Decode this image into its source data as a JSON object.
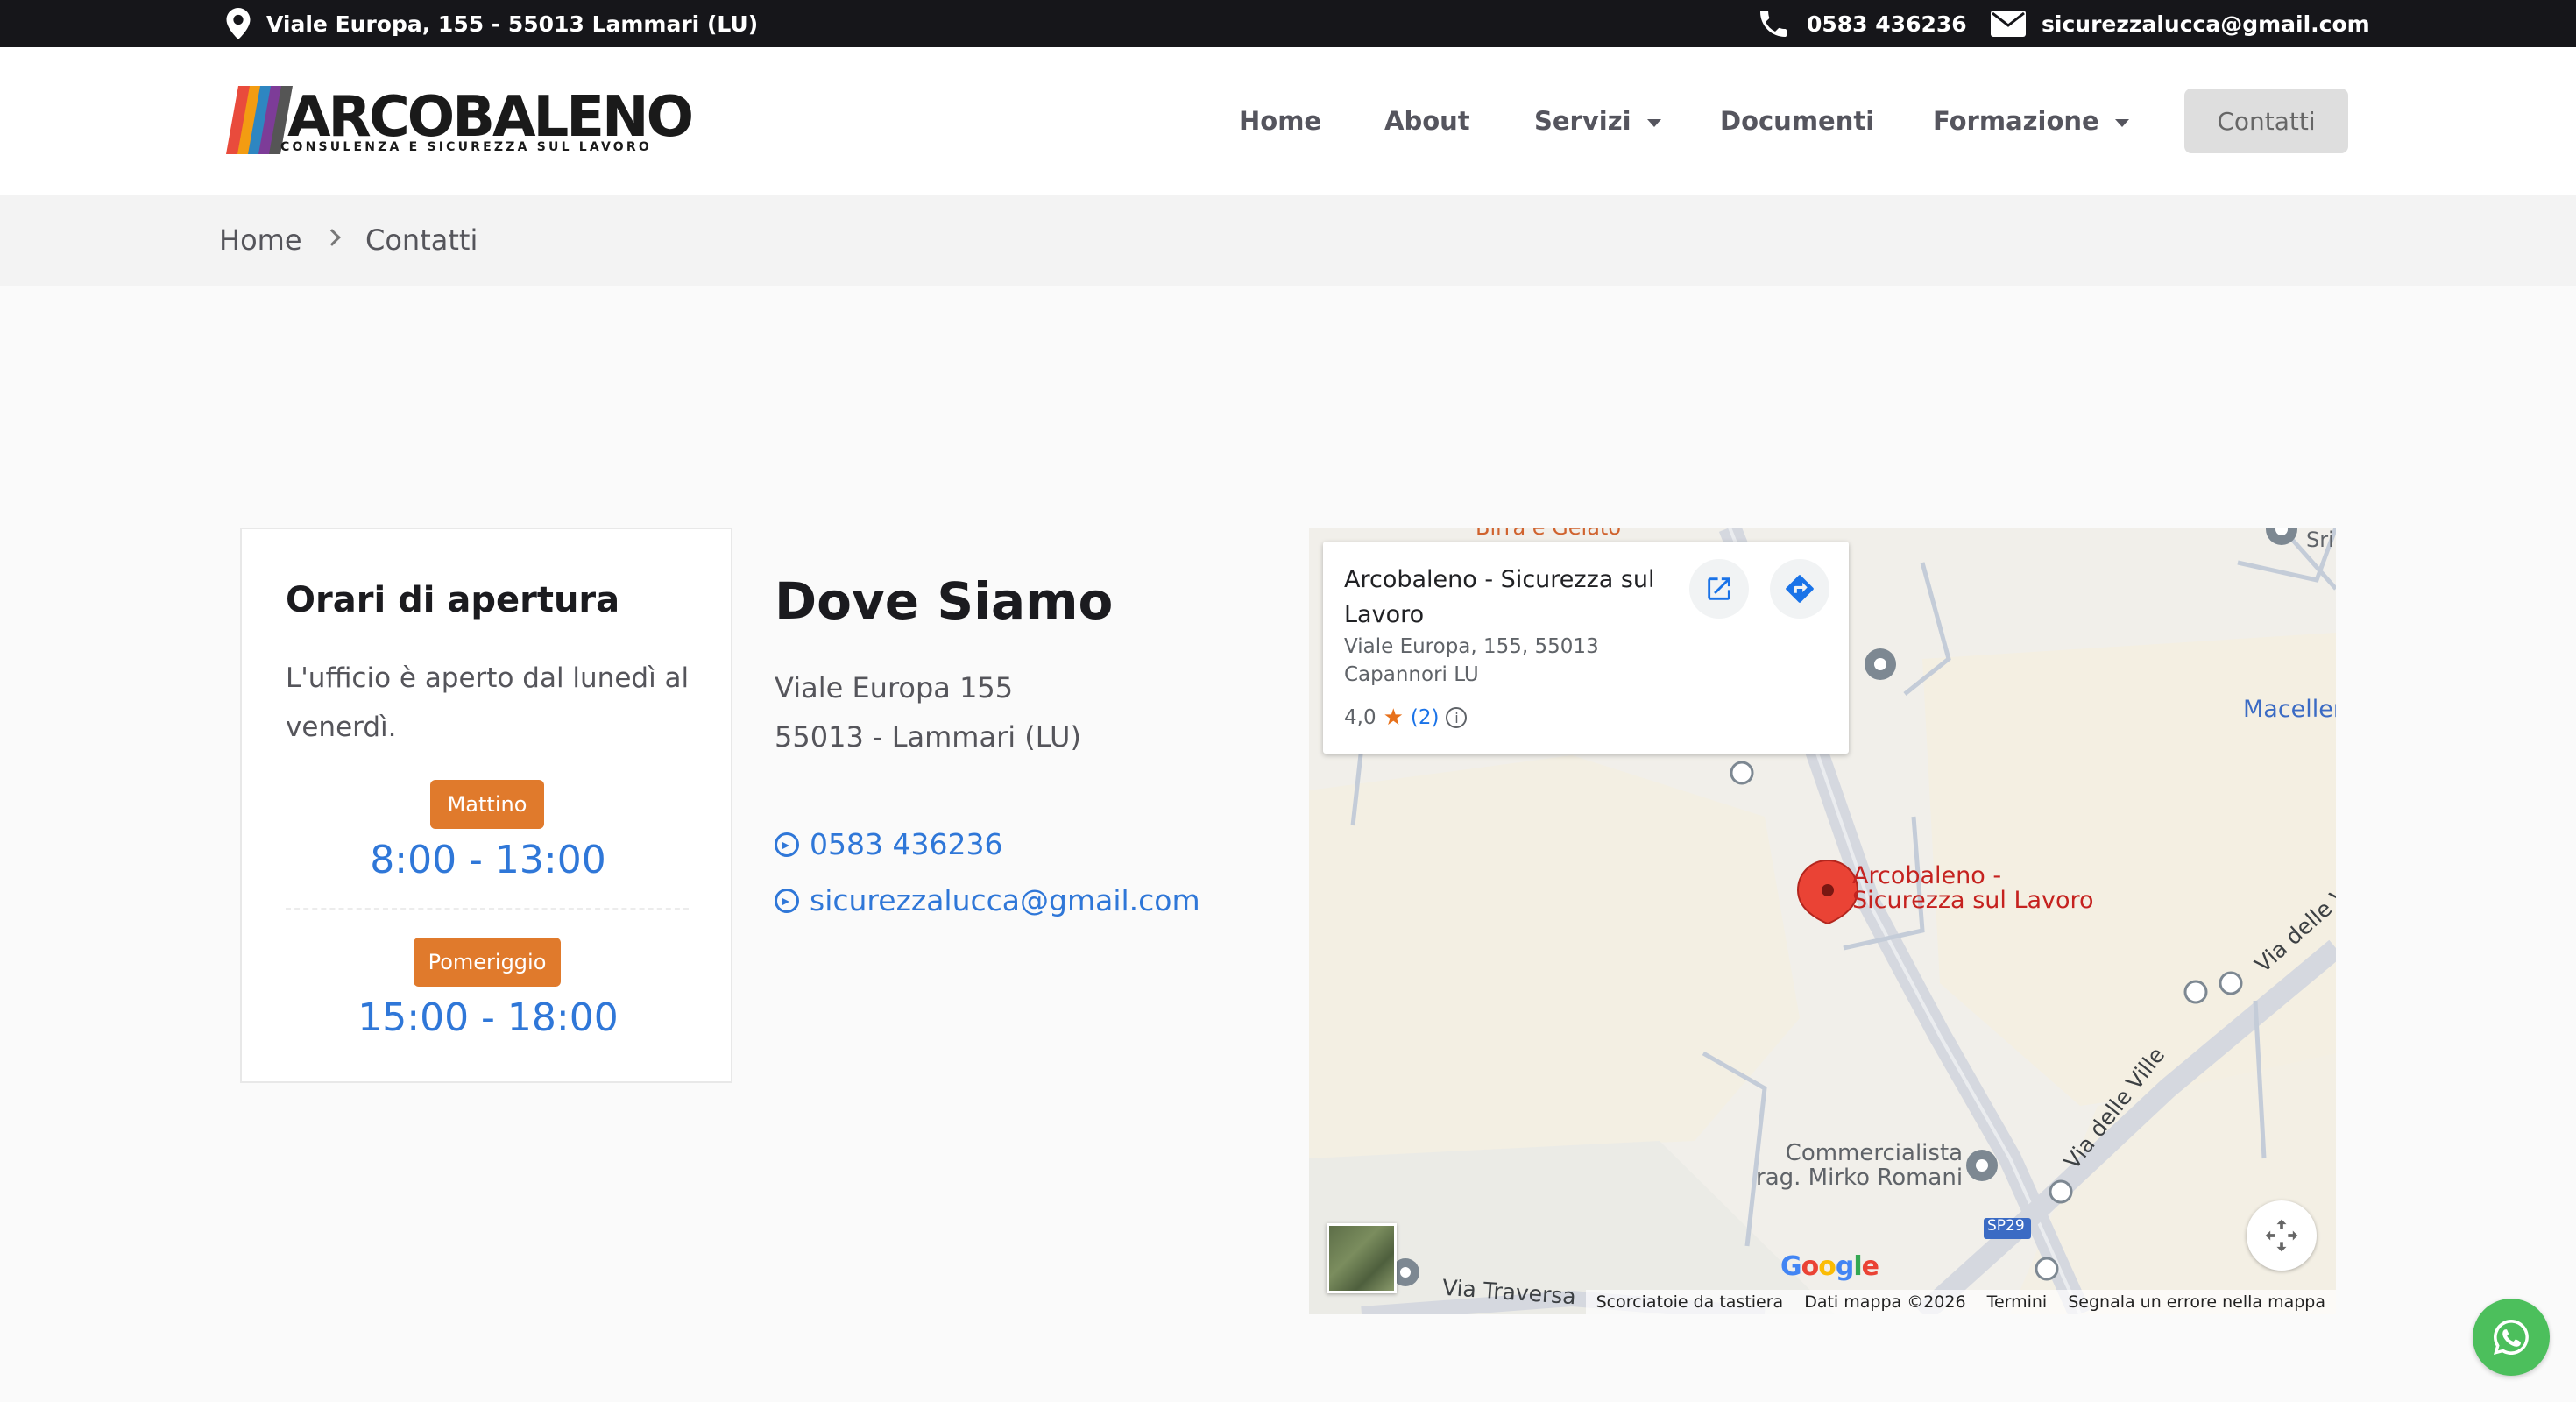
{
  "topbar": {
    "address": "Viale Europa, 155 - 55013 Lammari (LU)",
    "phone": "0583 436236",
    "email": "sicurezzalucca@gmail.com"
  },
  "logo": {
    "word": "ARCOBALENO",
    "tagline": "CONSULENZA E SICUREZZA SUL LAVORO"
  },
  "nav": {
    "items": [
      {
        "label": "Home"
      },
      {
        "label": "About"
      },
      {
        "label": "Servizi"
      },
      {
        "label": "Documenti"
      },
      {
        "label": "Formazione"
      }
    ],
    "cta": "Contatti"
  },
  "breadcrumb": {
    "home": "Home",
    "current": "Contatti"
  },
  "hours": {
    "title": "Orari di apertura",
    "description": "L'ufficio è aperto dal lunedì al venerdì.",
    "morning_label": "Mattino",
    "morning_time": "8:00 - 13:00",
    "afternoon_label": "Pomeriggio",
    "afternoon_time": "15:00 - 18:00"
  },
  "location": {
    "title": "Dove Siamo",
    "street": "Viale Europa 155",
    "city": "55013 - Lammari (LU)",
    "phone": "0583 436236",
    "email": "sicurezzalucca@gmail.com"
  },
  "map": {
    "place_name": "Arcobaleno - Sicurezza sul Lavoro",
    "place_address": "Viale Europa, 155, 55013 Capannori LU",
    "rating": "4,0",
    "reviews": "(2)",
    "marker_label_1": "Arcobaleno -",
    "marker_label_2": "Sicurezza sul Lavoro",
    "poi_1_line1": "Commercialista",
    "poi_1_line2": "rag. Mirko Romani",
    "poi_2": "Maceller",
    "poi_3": "Sri",
    "poi_4": "Birra e Gelato",
    "road_1": "Via delle Ville",
    "road_2": "Via delle V",
    "road_3": "Via Traversa",
    "road_sign": "SP29",
    "google": "Google",
    "footer": {
      "shortcuts": "Scorciatoie da tastiera",
      "data": "Dati mappa ©2026",
      "terms": "Termini",
      "report": "Segnala un errore nella mappa"
    }
  },
  "colors": {
    "accent_blue": "#2f77d8",
    "badge_orange": "#e07a2c",
    "topbar": "#16161a",
    "whatsapp": "#4cbf5c",
    "marker_red": "#ea4335"
  }
}
